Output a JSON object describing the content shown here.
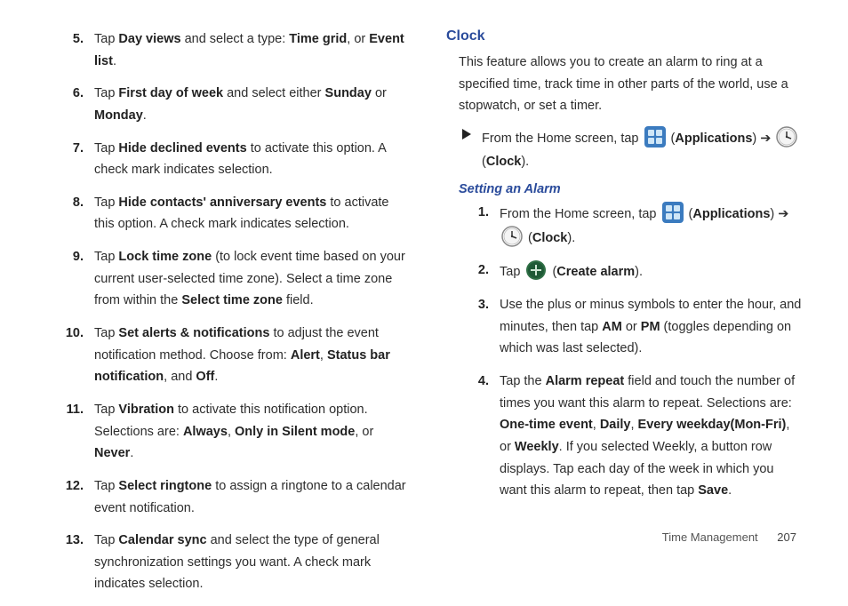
{
  "left": {
    "items": [
      {
        "num": "5.",
        "parts": [
          "Tap ",
          {
            "b": "Day views"
          },
          " and select a type: ",
          {
            "b": "Time grid"
          },
          ", or ",
          {
            "b": "Event list"
          },
          "."
        ]
      },
      {
        "num": "6.",
        "parts": [
          "Tap ",
          {
            "b": "First day of week"
          },
          " and select either ",
          {
            "b": "Sunday"
          },
          " or ",
          {
            "b": "Monday"
          },
          "."
        ]
      },
      {
        "num": "7.",
        "parts": [
          "Tap ",
          {
            "b": "Hide declined events"
          },
          " to activate this option. A check mark indicates selection."
        ]
      },
      {
        "num": "8.",
        "parts": [
          "Tap ",
          {
            "b": "Hide contacts' anniversary events"
          },
          " to activate this option. A check mark indicates selection."
        ]
      },
      {
        "num": "9.",
        "parts": [
          "Tap ",
          {
            "b": "Lock time zone"
          },
          " (to lock event time based on your current user-selected time zone). Select a time zone from within the ",
          {
            "b": "Select time zone"
          },
          " field."
        ]
      },
      {
        "num": "10.",
        "parts": [
          "Tap ",
          {
            "b": "Set alerts & notifications"
          },
          " to adjust the event notification method. Choose from: ",
          {
            "b": "Alert"
          },
          ", ",
          {
            "b": "Status bar notification"
          },
          ", and ",
          {
            "b": "Off"
          },
          "."
        ]
      },
      {
        "num": "11.",
        "parts": [
          "Tap ",
          {
            "b": "Vibration"
          },
          " to activate this notification option. Selections are: ",
          {
            "b": "Always"
          },
          ", ",
          {
            "b": "Only in Silent mode"
          },
          ", or ",
          {
            "b": "Never"
          },
          "."
        ]
      },
      {
        "num": "12.",
        "parts": [
          "Tap ",
          {
            "b": "Select ringtone"
          },
          " to assign a ringtone to a calendar event notification."
        ]
      },
      {
        "num": "13.",
        "parts": [
          "Tap ",
          {
            "b": "Calendar sync"
          },
          " and select the type of general synchronization settings you want. A check mark indicates selection."
        ]
      }
    ]
  },
  "right": {
    "heading": "Clock",
    "intro": "This feature allows you to create an alarm to ring at a specified time, track time in other parts of the world, use a stopwatch, or set a timer.",
    "bullet": {
      "parts": [
        "From the Home screen, tap ",
        {
          "icon": "apps"
        },
        " (",
        {
          "b": "Applications"
        },
        ") ➔ ",
        {
          "icon": "clock"
        },
        " (",
        {
          "b": "Clock"
        },
        ")."
      ]
    },
    "sub": "Setting an Alarm",
    "steps": [
      {
        "num": "1.",
        "parts": [
          "From the Home screen, tap ",
          {
            "icon": "apps"
          },
          " (",
          {
            "b": "Applications"
          },
          ") ➔ ",
          {
            "icon": "clock"
          },
          " (",
          {
            "b": "Clock"
          },
          ")."
        ]
      },
      {
        "num": "2.",
        "parts": [
          "Tap ",
          {
            "icon": "plus"
          },
          " (",
          {
            "b": "Create alarm"
          },
          ")."
        ]
      },
      {
        "num": "3.",
        "parts": [
          "Use the plus or minus symbols to enter the hour, and minutes, then tap ",
          {
            "b": "AM"
          },
          " or ",
          {
            "b": "PM"
          },
          " (toggles depending on which was last selected)."
        ]
      },
      {
        "num": "4.",
        "parts": [
          "Tap the ",
          {
            "b": "Alarm repeat"
          },
          " field and touch the number of times you want this alarm to repeat. Selections are: ",
          {
            "b": "One-time event"
          },
          ", ",
          {
            "b": "Daily"
          },
          ", ",
          {
            "b": "Every weekday(Mon-Fri)"
          },
          ", or ",
          {
            "b": "Weekly"
          },
          ". If you selected Weekly, a button row displays. Tap each day of the week in which you want this alarm to repeat, then tap ",
          {
            "b": "Save"
          },
          "."
        ]
      }
    ]
  },
  "footer": {
    "section": "Time Management",
    "page": "207"
  }
}
